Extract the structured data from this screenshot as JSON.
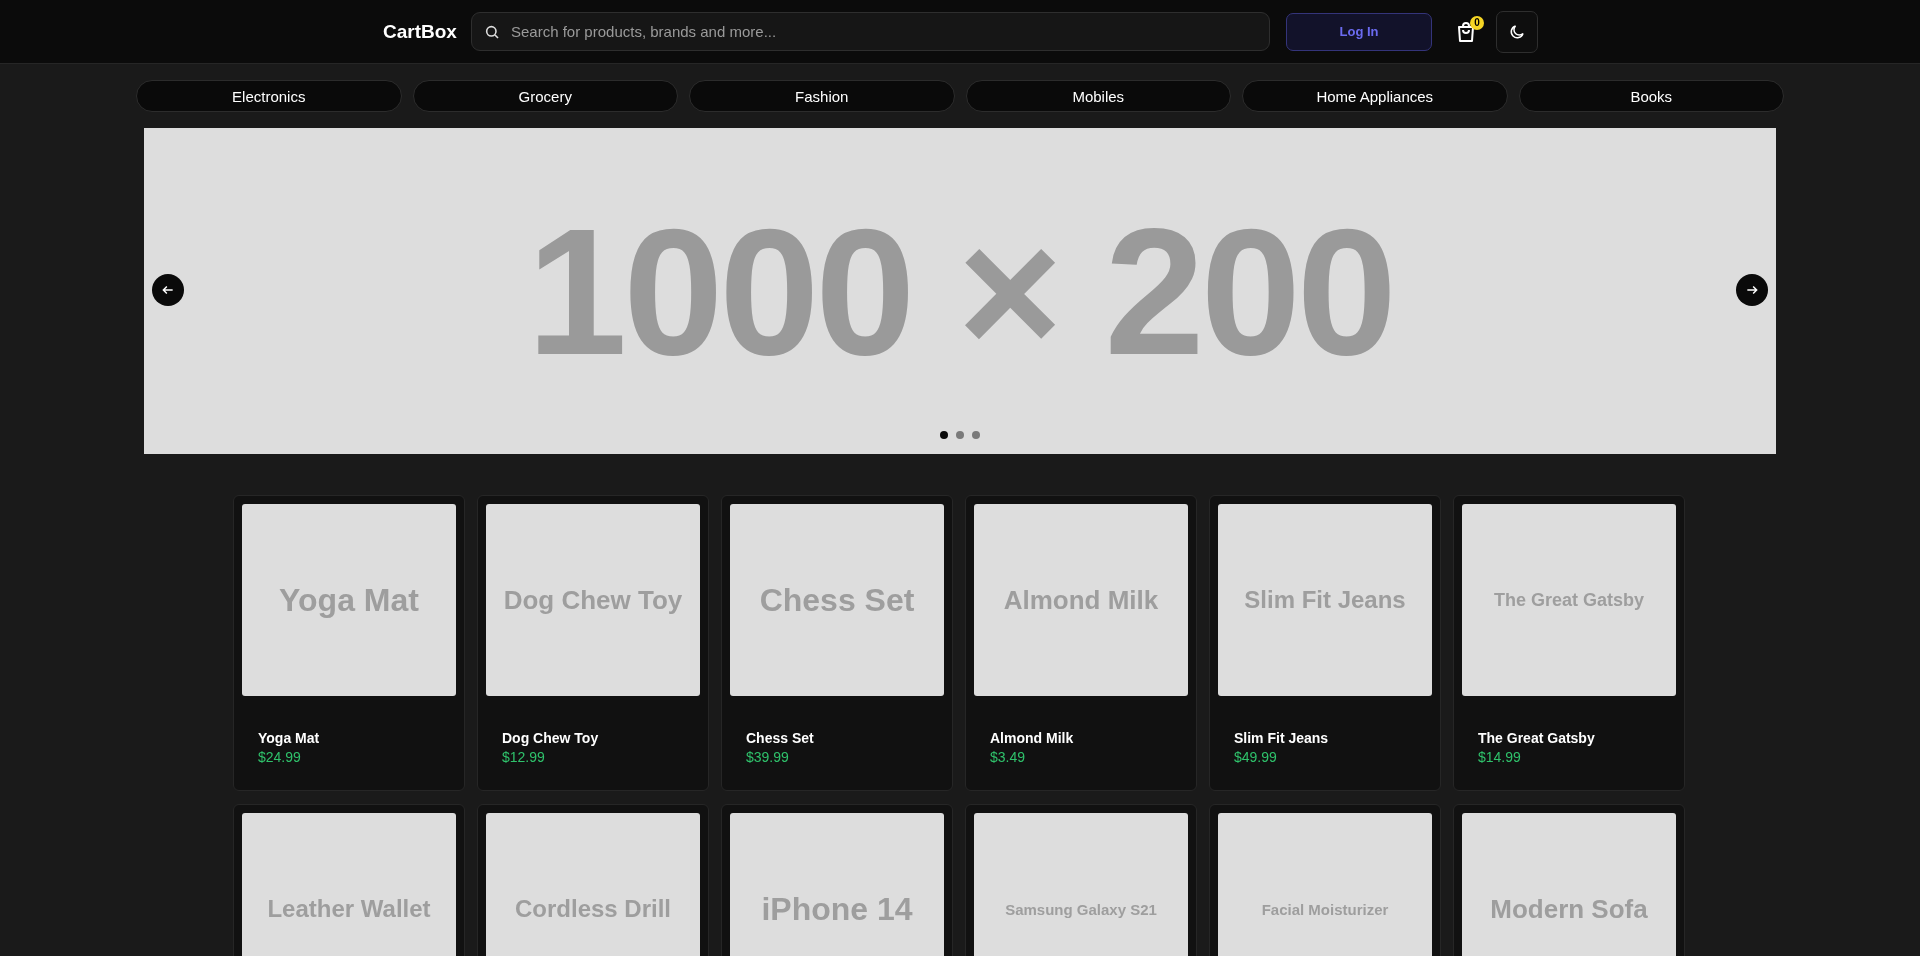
{
  "header": {
    "logo": "CartBox",
    "search": {
      "placeholder": "Search for products, brands and more..."
    },
    "login_button": "Log In",
    "cart_count": "0"
  },
  "categories": [
    {
      "label": "Electronics"
    },
    {
      "label": "Grocery"
    },
    {
      "label": "Fashion"
    },
    {
      "label": "Mobiles"
    },
    {
      "label": "Home Appliances"
    },
    {
      "label": "Books"
    }
  ],
  "banner": {
    "image_text": "1000 × 200",
    "dots": [
      {
        "selected": true
      },
      {
        "selected": false
      },
      {
        "selected": false
      }
    ]
  },
  "products": [
    {
      "name": "Yoga Mat",
      "price": "$24.99",
      "image_text": "Yoga Mat"
    },
    {
      "name": "Dog Chew Toy",
      "price": "$12.99",
      "image_text": "Dog Chew Toy"
    },
    {
      "name": "Chess Set",
      "price": "$39.99",
      "image_text": "Chess Set"
    },
    {
      "name": "Almond Milk",
      "price": "$3.49",
      "image_text": "Almond Milk"
    },
    {
      "name": "Slim Fit Jeans",
      "price": "$49.99",
      "image_text": "Slim Fit Jeans"
    },
    {
      "name": "The Great Gatsby",
      "price": "$14.99",
      "image_text": "The Great Gatsby"
    },
    {
      "image_text": "Leather Wallet"
    },
    {
      "image_text": "Cordless Drill"
    },
    {
      "image_text": "iPhone 14"
    },
    {
      "image_text": "Samsung Galaxy S21"
    },
    {
      "image_text": "Facial Moisturizer"
    },
    {
      "image_text": "Modern Sofa"
    }
  ]
}
